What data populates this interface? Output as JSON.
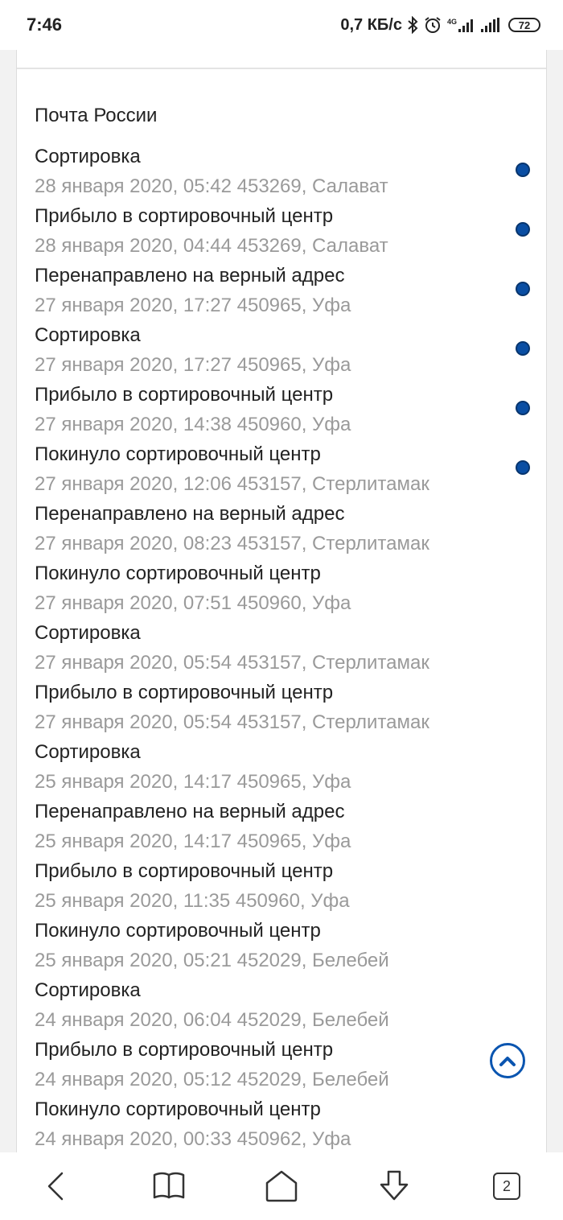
{
  "status_bar": {
    "time": "7:46",
    "speed": "0,7 КБ/с",
    "network": "4G",
    "battery": "72"
  },
  "tracking": {
    "provider": "Почта России",
    "events": [
      {
        "status": "Сортировка",
        "meta": "28 января 2020, 05:42 453269, Салават"
      },
      {
        "status": "Прибыло в сортировочный центр",
        "meta": "28 января 2020, 04:44 453269, Салават"
      },
      {
        "status": "Перенаправлено на верный адрес",
        "meta": "27 января 2020, 17:27 450965, Уфа"
      },
      {
        "status": "Сортировка",
        "meta": "27 января 2020, 17:27 450965, Уфа"
      },
      {
        "status": "Прибыло в сортировочный центр",
        "meta": "27 января 2020, 14:38 450960, Уфа"
      },
      {
        "status": "Покинуло сортировочный центр",
        "meta": "27 января 2020, 12:06 453157, Стерлитамак"
      },
      {
        "status": "Перенаправлено на верный адрес",
        "meta": "27 января 2020, 08:23 453157, Стерлитамак"
      },
      {
        "status": "Покинуло сортировочный центр",
        "meta": "27 января 2020, 07:51 450960, Уфа"
      },
      {
        "status": "Сортировка",
        "meta": "27 января 2020, 05:54 453157, Стерлитамак"
      },
      {
        "status": "Прибыло в сортировочный центр",
        "meta": "27 января 2020, 05:54 453157, Стерлитамак"
      },
      {
        "status": "Сортировка",
        "meta": "25 января 2020, 14:17 450965, Уфа"
      },
      {
        "status": "Перенаправлено на верный адрес",
        "meta": "25 января 2020, 14:17 450965, Уфа"
      },
      {
        "status": "Прибыло в сортировочный центр",
        "meta": "25 января 2020, 11:35 450960, Уфа"
      },
      {
        "status": "Покинуло сортировочный центр",
        "meta": "25 января 2020, 05:21 452029, Белебей"
      },
      {
        "status": "Сортировка",
        "meta": "24 января 2020, 06:04 452029, Белебей"
      },
      {
        "status": "Прибыло в сортировочный центр",
        "meta": "24 января 2020, 05:12 452029, Белебей"
      },
      {
        "status": "Покинуло сортировочный центр",
        "meta": "24 января 2020, 00:33 450962, Уфа"
      }
    ],
    "timeline_dot_count": 6,
    "dot_color": "#0a4ea3"
  },
  "scroll_top_icon": "chevron-up-circle-icon",
  "nav_bar": {
    "icons": [
      "back-icon",
      "book-icon",
      "home-icon",
      "download-icon",
      "tabs-icon"
    ],
    "tabs_count": "2"
  }
}
